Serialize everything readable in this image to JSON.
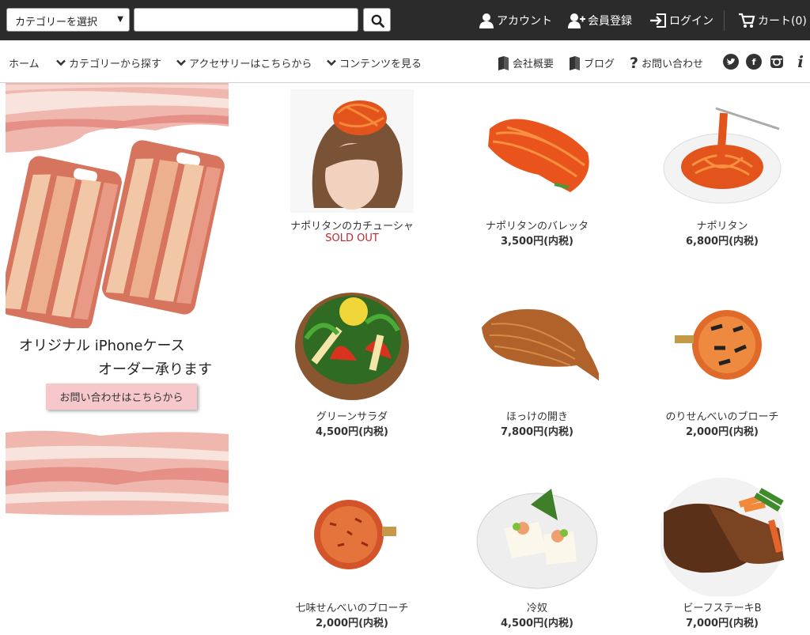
{
  "topbar": {
    "category_select": "カテゴリーを選択",
    "search_placeholder": "",
    "account": "アカウント",
    "register": "会員登録",
    "login": "ログイン",
    "cart": "カート(0)"
  },
  "nav": {
    "home": "ホーム",
    "by_category": "カテゴリーから探す",
    "accessories": "アクセサリーはこちらから",
    "contents": "コンテンツを見る",
    "company": "会社概要",
    "blog": "ブログ",
    "contact": "お問い合わせ",
    "social": [
      "twitter-icon",
      "facebook-icon",
      "instagram-icon",
      "info-icon"
    ]
  },
  "promo": {
    "title_line1": "オリジナル iPhoneケース",
    "title_line2": "オーダー承ります",
    "button": "お問い合わせはこちらから"
  },
  "products": [
    {
      "name": "ナポリタンのカチューシャ",
      "price": "",
      "status": "SOLD OUT"
    },
    {
      "name": "ナポリタンのバレッタ",
      "price": "3,500円(内税)",
      "status": ""
    },
    {
      "name": "ナポリタン",
      "price": "6,800円(内税)",
      "status": ""
    },
    {
      "name": "グリーンサラダ",
      "price": "4,500円(内税)",
      "status": ""
    },
    {
      "name": "ほっけの開き",
      "price": "7,800円(内税)",
      "status": ""
    },
    {
      "name": "のりせんべいのブローチ",
      "price": "2,000円(内税)",
      "status": ""
    },
    {
      "name": "七味せんべいのブローチ",
      "price": "2,000円(内税)",
      "status": ""
    },
    {
      "name": "冷奴",
      "price": "4,500円(内税)",
      "status": ""
    },
    {
      "name": "ビーフステーキB",
      "price": "7,000円(内税)",
      "status": ""
    }
  ],
  "colors": {
    "topbar_bg": "#2b2b2b",
    "soldout": "#c0282d",
    "promo_button": "#f6c8cc"
  }
}
